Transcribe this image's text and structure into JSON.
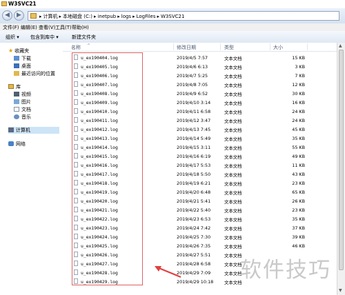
{
  "window": {
    "title": "W3SVC21"
  },
  "address": {
    "path": [
      "计算机",
      "本地磁盘 (C:)",
      "inetpub",
      "logs",
      "LogFiles",
      "W3SVC21"
    ],
    "separator": "▸",
    "lead_separator": "▸"
  },
  "menu": [
    "文件(F)",
    "编辑(E)",
    "查看(V)",
    "工具(T)",
    "帮助(H)"
  ],
  "toolbar": {
    "organize": "组织 ▾",
    "include": "包含到库中 ▾",
    "new_folder": "新建文件夹"
  },
  "sidebar": {
    "favorites": {
      "label": "收藏夹",
      "items": [
        "下载",
        "桌面",
        "最近访问的位置"
      ]
    },
    "libraries": {
      "label": "库",
      "items": [
        "视频",
        "图片",
        "文档",
        "音乐"
      ]
    },
    "computer": "计算机",
    "network": "网络"
  },
  "columns": {
    "name": "名称",
    "date": "修改日期",
    "type": "类型",
    "size": "大小"
  },
  "files": [
    {
      "name": "u_ex190404.log",
      "date": "2019/4/5 7:57",
      "type": "文本文档",
      "size": "15 KB"
    },
    {
      "name": "u_ex190405.log",
      "date": "2019/4/6 6:13",
      "type": "文本文档",
      "size": "3 KB"
    },
    {
      "name": "u_ex190406.log",
      "date": "2019/4/7 5:25",
      "type": "文本文档",
      "size": "7 KB"
    },
    {
      "name": "u_ex190407.log",
      "date": "2019/4/8 7:05",
      "type": "文本文档",
      "size": "12 KB"
    },
    {
      "name": "u_ex190408.log",
      "date": "2019/4/9 6:52",
      "type": "文本文档",
      "size": "30 KB"
    },
    {
      "name": "u_ex190409.log",
      "date": "2019/4/10 3:14",
      "type": "文本文档",
      "size": "16 KB"
    },
    {
      "name": "u_ex190410.log",
      "date": "2019/4/11 6:58",
      "type": "文本文档",
      "size": "24 KB"
    },
    {
      "name": "u_ex190411.log",
      "date": "2019/4/12 3:47",
      "type": "文本文档",
      "size": "24 KB"
    },
    {
      "name": "u_ex190412.log",
      "date": "2019/4/13 7:45",
      "type": "文本文档",
      "size": "45 KB"
    },
    {
      "name": "u_ex190413.log",
      "date": "2019/4/14 5:49",
      "type": "文本文档",
      "size": "35 KB"
    },
    {
      "name": "u_ex190414.log",
      "date": "2019/4/15 3:11",
      "type": "文本文档",
      "size": "55 KB"
    },
    {
      "name": "u_ex190415.log",
      "date": "2019/4/16 6:19",
      "type": "文本文档",
      "size": "49 KB"
    },
    {
      "name": "u_ex190416.log",
      "date": "2019/4/17 5:53",
      "type": "文本文档",
      "size": "11 KB"
    },
    {
      "name": "u_ex190417.log",
      "date": "2019/4/18 5:50",
      "type": "文本文档",
      "size": "43 KB"
    },
    {
      "name": "u_ex190418.log",
      "date": "2019/4/19 6:21",
      "type": "文本文档",
      "size": "23 KB"
    },
    {
      "name": "u_ex190419.log",
      "date": "2019/4/20 6:48",
      "type": "文本文档",
      "size": "65 KB"
    },
    {
      "name": "u_ex190420.log",
      "date": "2019/4/21 5:41",
      "type": "文本文档",
      "size": "26 KB"
    },
    {
      "name": "u_ex190421.log",
      "date": "2019/4/22 5:40",
      "type": "文本文档",
      "size": "23 KB"
    },
    {
      "name": "u_ex190422.log",
      "date": "2019/4/23 6:53",
      "type": "文本文档",
      "size": "35 KB"
    },
    {
      "name": "u_ex190423.log",
      "date": "2019/4/24 7:42",
      "type": "文本文档",
      "size": "37 KB"
    },
    {
      "name": "u_ex190424.log",
      "date": "2019/4/25 7:30",
      "type": "文本文档",
      "size": "39 KB"
    },
    {
      "name": "u_ex190425.log",
      "date": "2019/4/26 7:35",
      "type": "文本文档",
      "size": "46 KB"
    },
    {
      "name": "u_ex190426.log",
      "date": "2019/4/27 5:51",
      "type": "文本文档",
      "size": ""
    },
    {
      "name": "u_ex190427.log",
      "date": "2019/4/28 6:58",
      "type": "文本文档",
      "size": ""
    },
    {
      "name": "u_ex190428.log",
      "date": "2019/4/29 7:09",
      "type": "文本文档",
      "size": ""
    },
    {
      "name": "u_ex190429.log",
      "date": "2019/4/29 10:18",
      "type": "文本文档",
      "size": ""
    }
  ],
  "watermark": "软件技巧",
  "colors": {
    "highlight_box": "#e06060",
    "arrow": "#e04040"
  }
}
